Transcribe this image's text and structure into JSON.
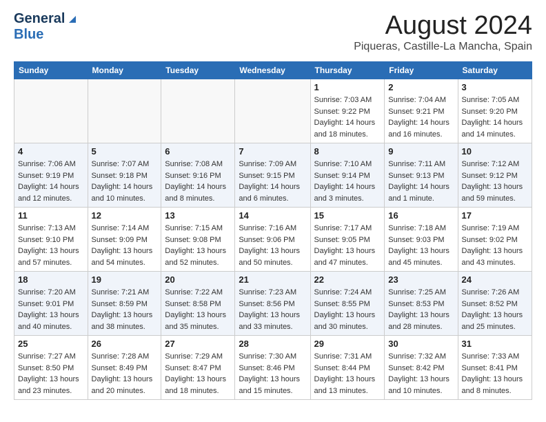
{
  "header": {
    "logo_general": "General",
    "logo_blue": "Blue",
    "month_title": "August 2024",
    "location": "Piqueras, Castille-La Mancha, Spain"
  },
  "weekdays": [
    "Sunday",
    "Monday",
    "Tuesday",
    "Wednesday",
    "Thursday",
    "Friday",
    "Saturday"
  ],
  "weeks": [
    [
      {
        "day": "",
        "info": ""
      },
      {
        "day": "",
        "info": ""
      },
      {
        "day": "",
        "info": ""
      },
      {
        "day": "",
        "info": ""
      },
      {
        "day": "1",
        "info": "Sunrise: 7:03 AM\nSunset: 9:22 PM\nDaylight: 14 hours\nand 18 minutes."
      },
      {
        "day": "2",
        "info": "Sunrise: 7:04 AM\nSunset: 9:21 PM\nDaylight: 14 hours\nand 16 minutes."
      },
      {
        "day": "3",
        "info": "Sunrise: 7:05 AM\nSunset: 9:20 PM\nDaylight: 14 hours\nand 14 minutes."
      }
    ],
    [
      {
        "day": "4",
        "info": "Sunrise: 7:06 AM\nSunset: 9:19 PM\nDaylight: 14 hours\nand 12 minutes."
      },
      {
        "day": "5",
        "info": "Sunrise: 7:07 AM\nSunset: 9:18 PM\nDaylight: 14 hours\nand 10 minutes."
      },
      {
        "day": "6",
        "info": "Sunrise: 7:08 AM\nSunset: 9:16 PM\nDaylight: 14 hours\nand 8 minutes."
      },
      {
        "day": "7",
        "info": "Sunrise: 7:09 AM\nSunset: 9:15 PM\nDaylight: 14 hours\nand 6 minutes."
      },
      {
        "day": "8",
        "info": "Sunrise: 7:10 AM\nSunset: 9:14 PM\nDaylight: 14 hours\nand 3 minutes."
      },
      {
        "day": "9",
        "info": "Sunrise: 7:11 AM\nSunset: 9:13 PM\nDaylight: 14 hours\nand 1 minute."
      },
      {
        "day": "10",
        "info": "Sunrise: 7:12 AM\nSunset: 9:12 PM\nDaylight: 13 hours\nand 59 minutes."
      }
    ],
    [
      {
        "day": "11",
        "info": "Sunrise: 7:13 AM\nSunset: 9:10 PM\nDaylight: 13 hours\nand 57 minutes."
      },
      {
        "day": "12",
        "info": "Sunrise: 7:14 AM\nSunset: 9:09 PM\nDaylight: 13 hours\nand 54 minutes."
      },
      {
        "day": "13",
        "info": "Sunrise: 7:15 AM\nSunset: 9:08 PM\nDaylight: 13 hours\nand 52 minutes."
      },
      {
        "day": "14",
        "info": "Sunrise: 7:16 AM\nSunset: 9:06 PM\nDaylight: 13 hours\nand 50 minutes."
      },
      {
        "day": "15",
        "info": "Sunrise: 7:17 AM\nSunset: 9:05 PM\nDaylight: 13 hours\nand 47 minutes."
      },
      {
        "day": "16",
        "info": "Sunrise: 7:18 AM\nSunset: 9:03 PM\nDaylight: 13 hours\nand 45 minutes."
      },
      {
        "day": "17",
        "info": "Sunrise: 7:19 AM\nSunset: 9:02 PM\nDaylight: 13 hours\nand 43 minutes."
      }
    ],
    [
      {
        "day": "18",
        "info": "Sunrise: 7:20 AM\nSunset: 9:01 PM\nDaylight: 13 hours\nand 40 minutes."
      },
      {
        "day": "19",
        "info": "Sunrise: 7:21 AM\nSunset: 8:59 PM\nDaylight: 13 hours\nand 38 minutes."
      },
      {
        "day": "20",
        "info": "Sunrise: 7:22 AM\nSunset: 8:58 PM\nDaylight: 13 hours\nand 35 minutes."
      },
      {
        "day": "21",
        "info": "Sunrise: 7:23 AM\nSunset: 8:56 PM\nDaylight: 13 hours\nand 33 minutes."
      },
      {
        "day": "22",
        "info": "Sunrise: 7:24 AM\nSunset: 8:55 PM\nDaylight: 13 hours\nand 30 minutes."
      },
      {
        "day": "23",
        "info": "Sunrise: 7:25 AM\nSunset: 8:53 PM\nDaylight: 13 hours\nand 28 minutes."
      },
      {
        "day": "24",
        "info": "Sunrise: 7:26 AM\nSunset: 8:52 PM\nDaylight: 13 hours\nand 25 minutes."
      }
    ],
    [
      {
        "day": "25",
        "info": "Sunrise: 7:27 AM\nSunset: 8:50 PM\nDaylight: 13 hours\nand 23 minutes."
      },
      {
        "day": "26",
        "info": "Sunrise: 7:28 AM\nSunset: 8:49 PM\nDaylight: 13 hours\nand 20 minutes."
      },
      {
        "day": "27",
        "info": "Sunrise: 7:29 AM\nSunset: 8:47 PM\nDaylight: 13 hours\nand 18 minutes."
      },
      {
        "day": "28",
        "info": "Sunrise: 7:30 AM\nSunset: 8:46 PM\nDaylight: 13 hours\nand 15 minutes."
      },
      {
        "day": "29",
        "info": "Sunrise: 7:31 AM\nSunset: 8:44 PM\nDaylight: 13 hours\nand 13 minutes."
      },
      {
        "day": "30",
        "info": "Sunrise: 7:32 AM\nSunset: 8:42 PM\nDaylight: 13 hours\nand 10 minutes."
      },
      {
        "day": "31",
        "info": "Sunrise: 7:33 AM\nSunset: 8:41 PM\nDaylight: 13 hours\nand 8 minutes."
      }
    ]
  ]
}
